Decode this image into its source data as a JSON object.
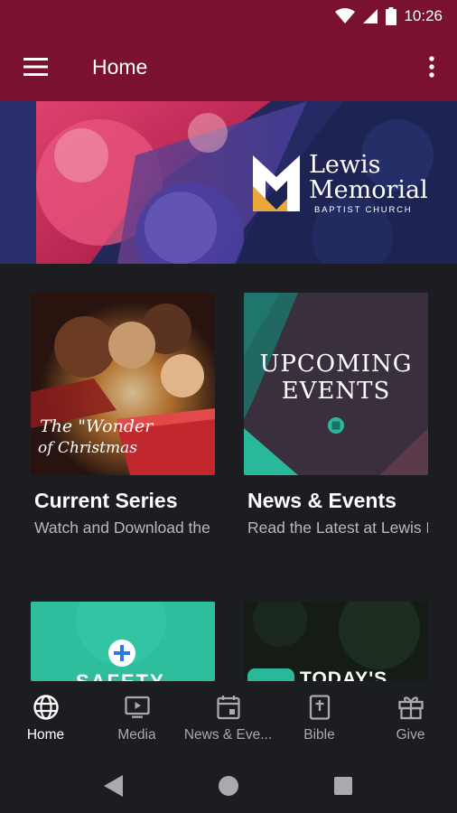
{
  "status_bar": {
    "time": "10:26"
  },
  "app_bar": {
    "title": "Home",
    "menu_icon": "hamburger-menu-icon",
    "more_icon": "more-vert-icon"
  },
  "hero": {
    "logo_line1": "Lewis",
    "logo_line2": "Memorial",
    "logo_sub": "BAPTIST CHURCH"
  },
  "cards": [
    {
      "title": "Current Series",
      "subtitle": "Watch and Download the Latest",
      "image_text_line1": "The \"Wonder",
      "image_text_line2": "of Christmas"
    },
    {
      "title": "News & Events",
      "subtitle": "Read the Latest at Lewis Memorial",
      "image_text_line1": "UPCOMING",
      "image_text_line2": "EVENTS"
    }
  ],
  "bottom_cards": [
    {
      "image_text": "SAFETY"
    },
    {
      "image_text": "TODAY'S"
    }
  ],
  "bottom_nav": [
    {
      "label": "Home",
      "icon": "globe-icon",
      "active": true
    },
    {
      "label": "Media",
      "icon": "tv-play-icon",
      "active": false
    },
    {
      "label": "News & Eve...",
      "icon": "calendar-icon",
      "active": false
    },
    {
      "label": "Bible",
      "icon": "bible-icon",
      "active": false
    },
    {
      "label": "Give",
      "icon": "gift-icon",
      "active": false
    }
  ],
  "colors": {
    "brand": "#7b1130",
    "background": "#1c1d20",
    "accent_teal": "#2ab89a"
  }
}
